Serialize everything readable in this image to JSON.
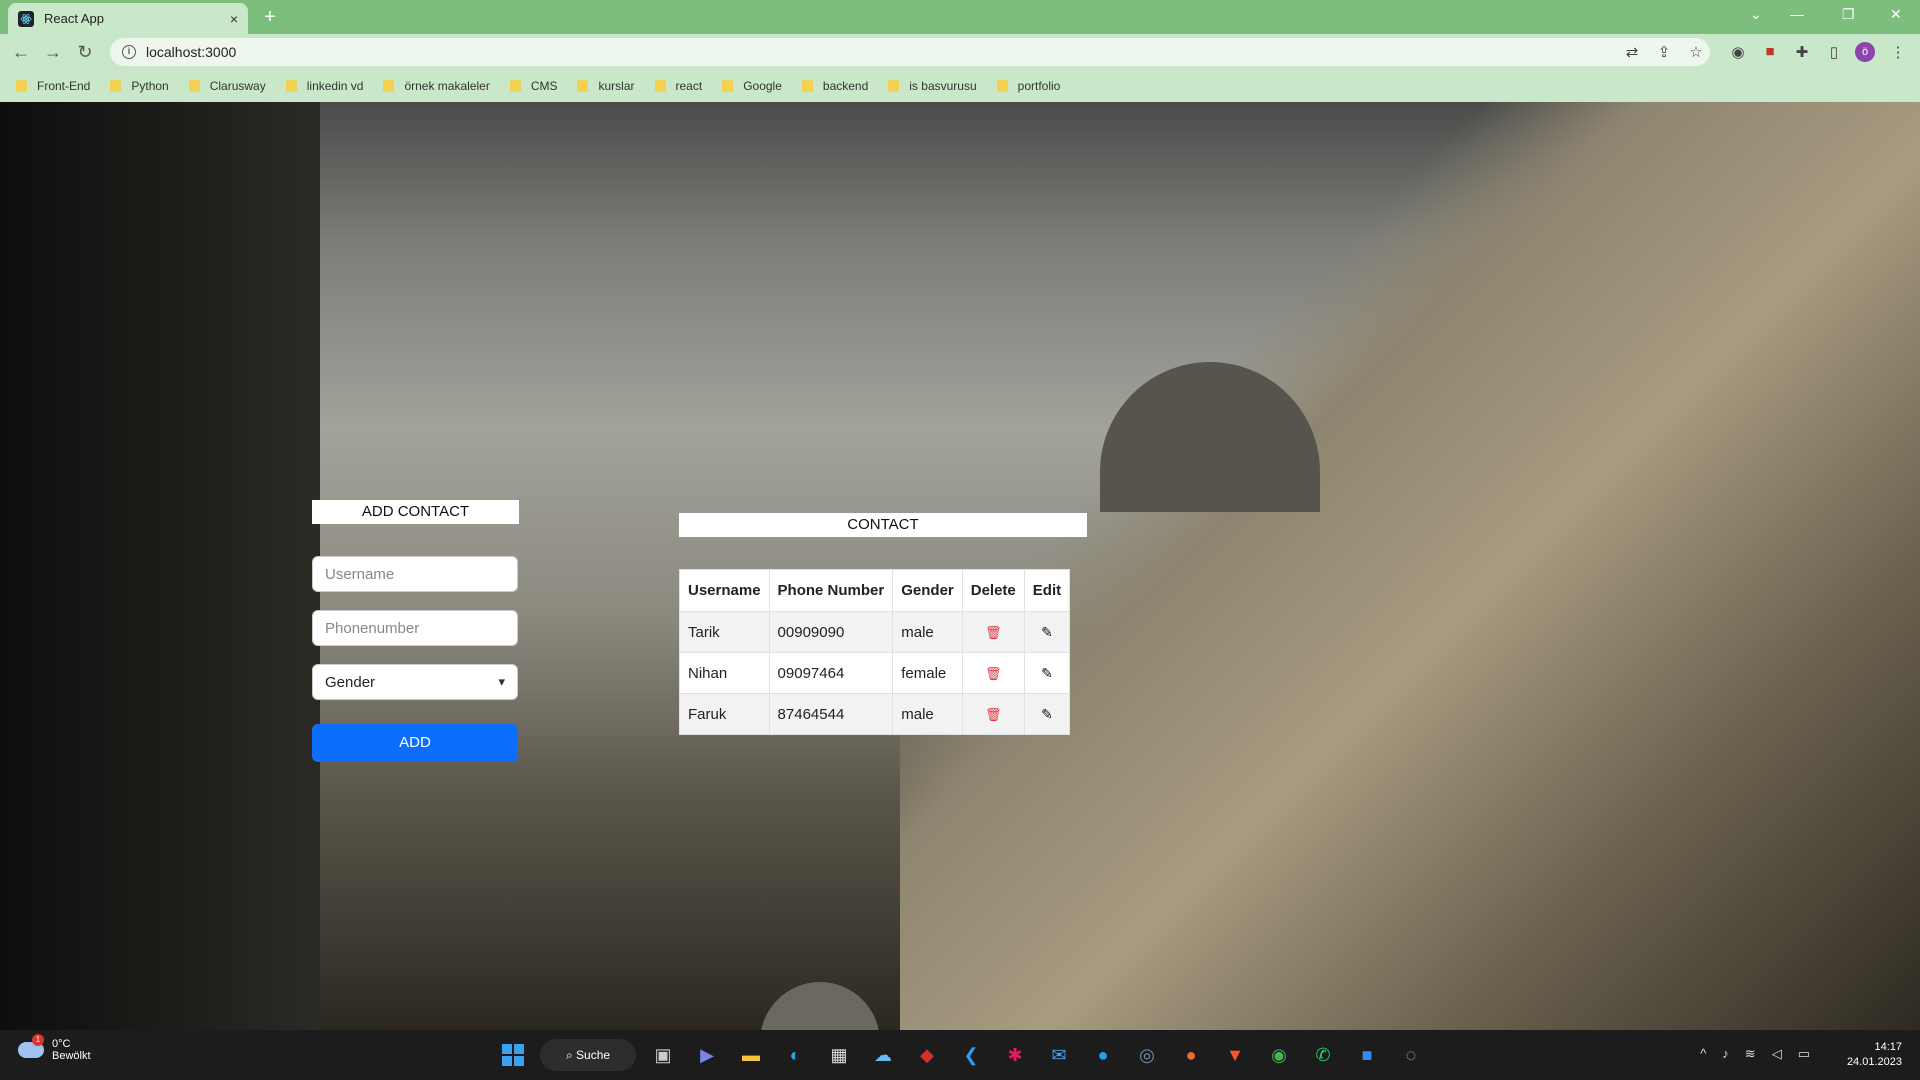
{
  "browser": {
    "tab_title": "React App",
    "tab_close": "×",
    "new_tab": "+",
    "url": "localhost:3000",
    "profile_initial": "ö",
    "bookmarks": [
      "Front-End",
      "Python",
      "Clarusway",
      "linkedin vd",
      "örnek makaleler",
      "CMS",
      "kurslar",
      "react",
      "Google",
      "backend",
      "is basvurusu",
      "portfolio"
    ]
  },
  "form": {
    "heading": "ADD CONTACT",
    "username_placeholder": "Username",
    "phone_placeholder": "Phonenumber",
    "gender_selected": "Gender",
    "add_label": "ADD"
  },
  "contacts": {
    "heading": "CONTACT",
    "columns": [
      "Username",
      "Phone Number",
      "Gender",
      "Delete",
      "Edit"
    ],
    "rows": [
      {
        "username": "Tarik",
        "phone": "00909090",
        "gender": "male"
      },
      {
        "username": "Nihan",
        "phone": "09097464",
        "gender": "female"
      },
      {
        "username": "Faruk",
        "phone": "87464544",
        "gender": "male"
      }
    ]
  },
  "taskbar": {
    "weather_temp": "0°C",
    "weather_desc": "Bewölkt",
    "weather_badge": "1",
    "search_label": "Suche",
    "time": "14:17",
    "date": "24.01.2023"
  },
  "colors": {
    "accent": "#0d6efd",
    "delete": "#dc3545",
    "chrome": "#7cbf7c"
  }
}
